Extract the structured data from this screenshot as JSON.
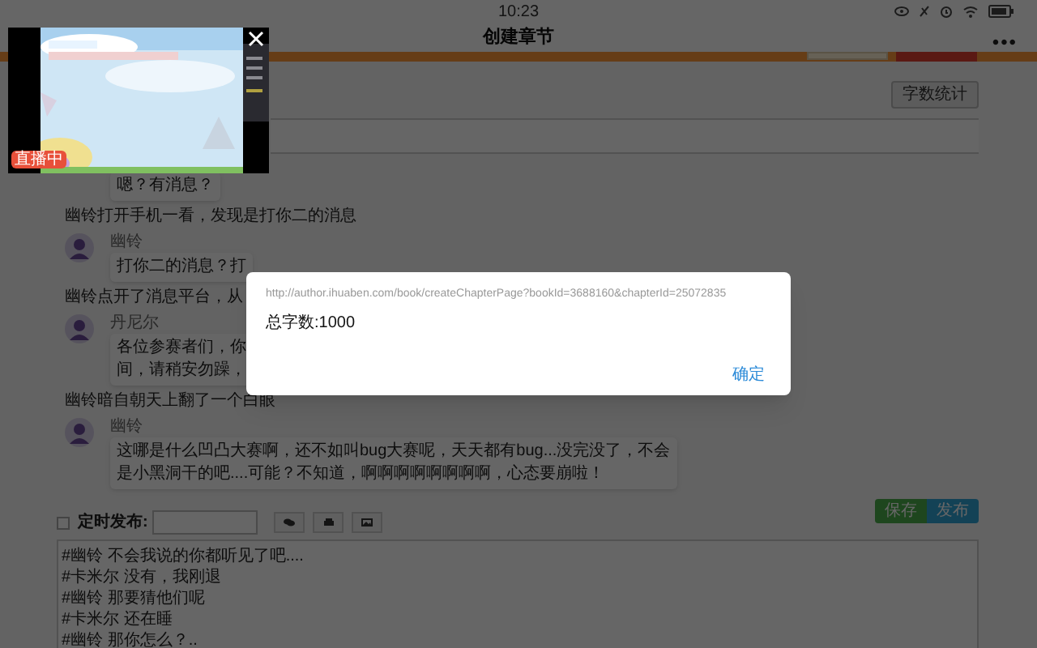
{
  "status_bar": {
    "time": "10:23"
  },
  "header": {
    "title": "创建章节",
    "menu": "•••"
  },
  "toolbar": {
    "word_count_button": "字数统计"
  },
  "messages": [
    {
      "kind": "bubble",
      "lines": [
        "嗯？有消息？"
      ]
    },
    {
      "kind": "narration",
      "lines": [
        "幽铃打开手机一看，发现是打你二的消息"
      ]
    },
    {
      "kind": "bubble",
      "name": "幽铃",
      "lines": [
        "打你二的消息？打"
      ]
    },
    {
      "kind": "narration",
      "lines": [
        "幽铃点开了消息平台，从"
      ]
    },
    {
      "kind": "bubble",
      "name": "丹尼尔",
      "lines": [
        "各位参赛者们，你",
        "间，请稍安勿躁，"
      ]
    },
    {
      "kind": "narration",
      "lines": [
        "幽铃暗自朝天上翻了一个白眼"
      ]
    },
    {
      "kind": "bubble",
      "name": "幽铃",
      "lines": [
        "这哪是什么凹凸大赛啊，还不如叫bug大赛呢，天天都有bug...没完没了，不会",
        "是小黑洞干的吧....可能？不知道，啊啊啊啊啊啊啊啊，心态要崩啦！"
      ]
    }
  ],
  "editor": {
    "schedule": {
      "label": "定时发布:",
      "checked": false
    },
    "save_button": "保存",
    "publish_button": "发布",
    "lines": [
      "#幽铃 不会我说的你都听见了吧....",
      "#卡米尔 没有，我刚退",
      "#幽铃 那要猜他们呢",
      "#卡米尔 还在睡",
      "#幽铃 那你怎么？.."
    ]
  },
  "video_overlay": {
    "kind": "picture",
    "badge": "直播中"
  },
  "dialog": {
    "url": "http://author.ihuaben.com/book/createChapterPage?bookId=3688160&chapterId=25072835",
    "message": "总字数:1000",
    "ok_button": "确定"
  }
}
